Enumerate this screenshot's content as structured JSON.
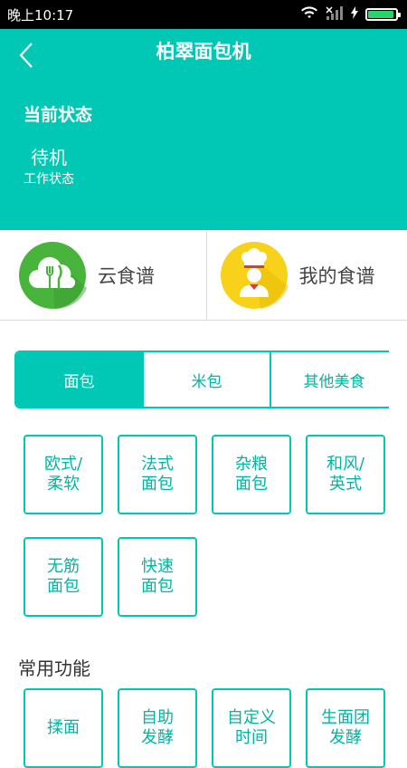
{
  "status_bar": {
    "time": "晚上10:17"
  },
  "header": {
    "title": "柏翠面包机",
    "state_heading": "当前状态",
    "state_value": "待机",
    "state_sub": "工作状态"
  },
  "recipes": [
    {
      "label": "云食谱",
      "icon": "cloud-utensils-icon"
    },
    {
      "label": "我的食谱",
      "icon": "chef-icon"
    }
  ],
  "tabs": [
    {
      "label": "面包",
      "active": true
    },
    {
      "label": "米包",
      "active": false
    },
    {
      "label": "其他美食",
      "active": false
    }
  ],
  "bread_types": [
    [
      "欧式/",
      "柔软"
    ],
    [
      "法式",
      "面包"
    ],
    [
      "杂粮",
      "面包"
    ],
    [
      "和风/",
      "英式"
    ],
    [
      "无筋",
      "面包"
    ],
    [
      "快速",
      "面包"
    ]
  ],
  "common_functions": {
    "title": "常用功能",
    "items": [
      [
        "揉面",
        ""
      ],
      [
        "自助",
        "发酵"
      ],
      [
        "自定义",
        "时间"
      ],
      [
        "生面团",
        "发酵"
      ]
    ]
  },
  "colors": {
    "accent": "#00c8b4",
    "green_icon": "#49b43c",
    "yellow_icon": "#f8d21a"
  }
}
